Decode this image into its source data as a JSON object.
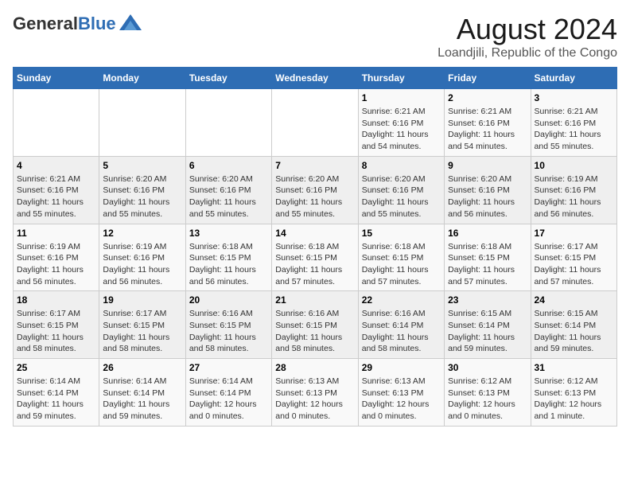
{
  "header": {
    "logo_general": "General",
    "logo_blue": "Blue",
    "main_title": "August 2024",
    "subtitle": "Loandjili, Republic of the Congo"
  },
  "calendar": {
    "days_of_week": [
      "Sunday",
      "Monday",
      "Tuesday",
      "Wednesday",
      "Thursday",
      "Friday",
      "Saturday"
    ],
    "weeks": [
      [
        {
          "day": "",
          "info": ""
        },
        {
          "day": "",
          "info": ""
        },
        {
          "day": "",
          "info": ""
        },
        {
          "day": "",
          "info": ""
        },
        {
          "day": "1",
          "info": "Sunrise: 6:21 AM\nSunset: 6:16 PM\nDaylight: 11 hours\nand 54 minutes."
        },
        {
          "day": "2",
          "info": "Sunrise: 6:21 AM\nSunset: 6:16 PM\nDaylight: 11 hours\nand 54 minutes."
        },
        {
          "day": "3",
          "info": "Sunrise: 6:21 AM\nSunset: 6:16 PM\nDaylight: 11 hours\nand 55 minutes."
        }
      ],
      [
        {
          "day": "4",
          "info": "Sunrise: 6:21 AM\nSunset: 6:16 PM\nDaylight: 11 hours\nand 55 minutes."
        },
        {
          "day": "5",
          "info": "Sunrise: 6:20 AM\nSunset: 6:16 PM\nDaylight: 11 hours\nand 55 minutes."
        },
        {
          "day": "6",
          "info": "Sunrise: 6:20 AM\nSunset: 6:16 PM\nDaylight: 11 hours\nand 55 minutes."
        },
        {
          "day": "7",
          "info": "Sunrise: 6:20 AM\nSunset: 6:16 PM\nDaylight: 11 hours\nand 55 minutes."
        },
        {
          "day": "8",
          "info": "Sunrise: 6:20 AM\nSunset: 6:16 PM\nDaylight: 11 hours\nand 55 minutes."
        },
        {
          "day": "9",
          "info": "Sunrise: 6:20 AM\nSunset: 6:16 PM\nDaylight: 11 hours\nand 56 minutes."
        },
        {
          "day": "10",
          "info": "Sunrise: 6:19 AM\nSunset: 6:16 PM\nDaylight: 11 hours\nand 56 minutes."
        }
      ],
      [
        {
          "day": "11",
          "info": "Sunrise: 6:19 AM\nSunset: 6:16 PM\nDaylight: 11 hours\nand 56 minutes."
        },
        {
          "day": "12",
          "info": "Sunrise: 6:19 AM\nSunset: 6:16 PM\nDaylight: 11 hours\nand 56 minutes."
        },
        {
          "day": "13",
          "info": "Sunrise: 6:18 AM\nSunset: 6:15 PM\nDaylight: 11 hours\nand 56 minutes."
        },
        {
          "day": "14",
          "info": "Sunrise: 6:18 AM\nSunset: 6:15 PM\nDaylight: 11 hours\nand 57 minutes."
        },
        {
          "day": "15",
          "info": "Sunrise: 6:18 AM\nSunset: 6:15 PM\nDaylight: 11 hours\nand 57 minutes."
        },
        {
          "day": "16",
          "info": "Sunrise: 6:18 AM\nSunset: 6:15 PM\nDaylight: 11 hours\nand 57 minutes."
        },
        {
          "day": "17",
          "info": "Sunrise: 6:17 AM\nSunset: 6:15 PM\nDaylight: 11 hours\nand 57 minutes."
        }
      ],
      [
        {
          "day": "18",
          "info": "Sunrise: 6:17 AM\nSunset: 6:15 PM\nDaylight: 11 hours\nand 58 minutes."
        },
        {
          "day": "19",
          "info": "Sunrise: 6:17 AM\nSunset: 6:15 PM\nDaylight: 11 hours\nand 58 minutes."
        },
        {
          "day": "20",
          "info": "Sunrise: 6:16 AM\nSunset: 6:15 PM\nDaylight: 11 hours\nand 58 minutes."
        },
        {
          "day": "21",
          "info": "Sunrise: 6:16 AM\nSunset: 6:15 PM\nDaylight: 11 hours\nand 58 minutes."
        },
        {
          "day": "22",
          "info": "Sunrise: 6:16 AM\nSunset: 6:14 PM\nDaylight: 11 hours\nand 58 minutes."
        },
        {
          "day": "23",
          "info": "Sunrise: 6:15 AM\nSunset: 6:14 PM\nDaylight: 11 hours\nand 59 minutes."
        },
        {
          "day": "24",
          "info": "Sunrise: 6:15 AM\nSunset: 6:14 PM\nDaylight: 11 hours\nand 59 minutes."
        }
      ],
      [
        {
          "day": "25",
          "info": "Sunrise: 6:14 AM\nSunset: 6:14 PM\nDaylight: 11 hours\nand 59 minutes."
        },
        {
          "day": "26",
          "info": "Sunrise: 6:14 AM\nSunset: 6:14 PM\nDaylight: 11 hours\nand 59 minutes."
        },
        {
          "day": "27",
          "info": "Sunrise: 6:14 AM\nSunset: 6:14 PM\nDaylight: 12 hours\nand 0 minutes."
        },
        {
          "day": "28",
          "info": "Sunrise: 6:13 AM\nSunset: 6:13 PM\nDaylight: 12 hours\nand 0 minutes."
        },
        {
          "day": "29",
          "info": "Sunrise: 6:13 AM\nSunset: 6:13 PM\nDaylight: 12 hours\nand 0 minutes."
        },
        {
          "day": "30",
          "info": "Sunrise: 6:12 AM\nSunset: 6:13 PM\nDaylight: 12 hours\nand 0 minutes."
        },
        {
          "day": "31",
          "info": "Sunrise: 6:12 AM\nSunset: 6:13 PM\nDaylight: 12 hours\nand 1 minute."
        }
      ]
    ]
  }
}
